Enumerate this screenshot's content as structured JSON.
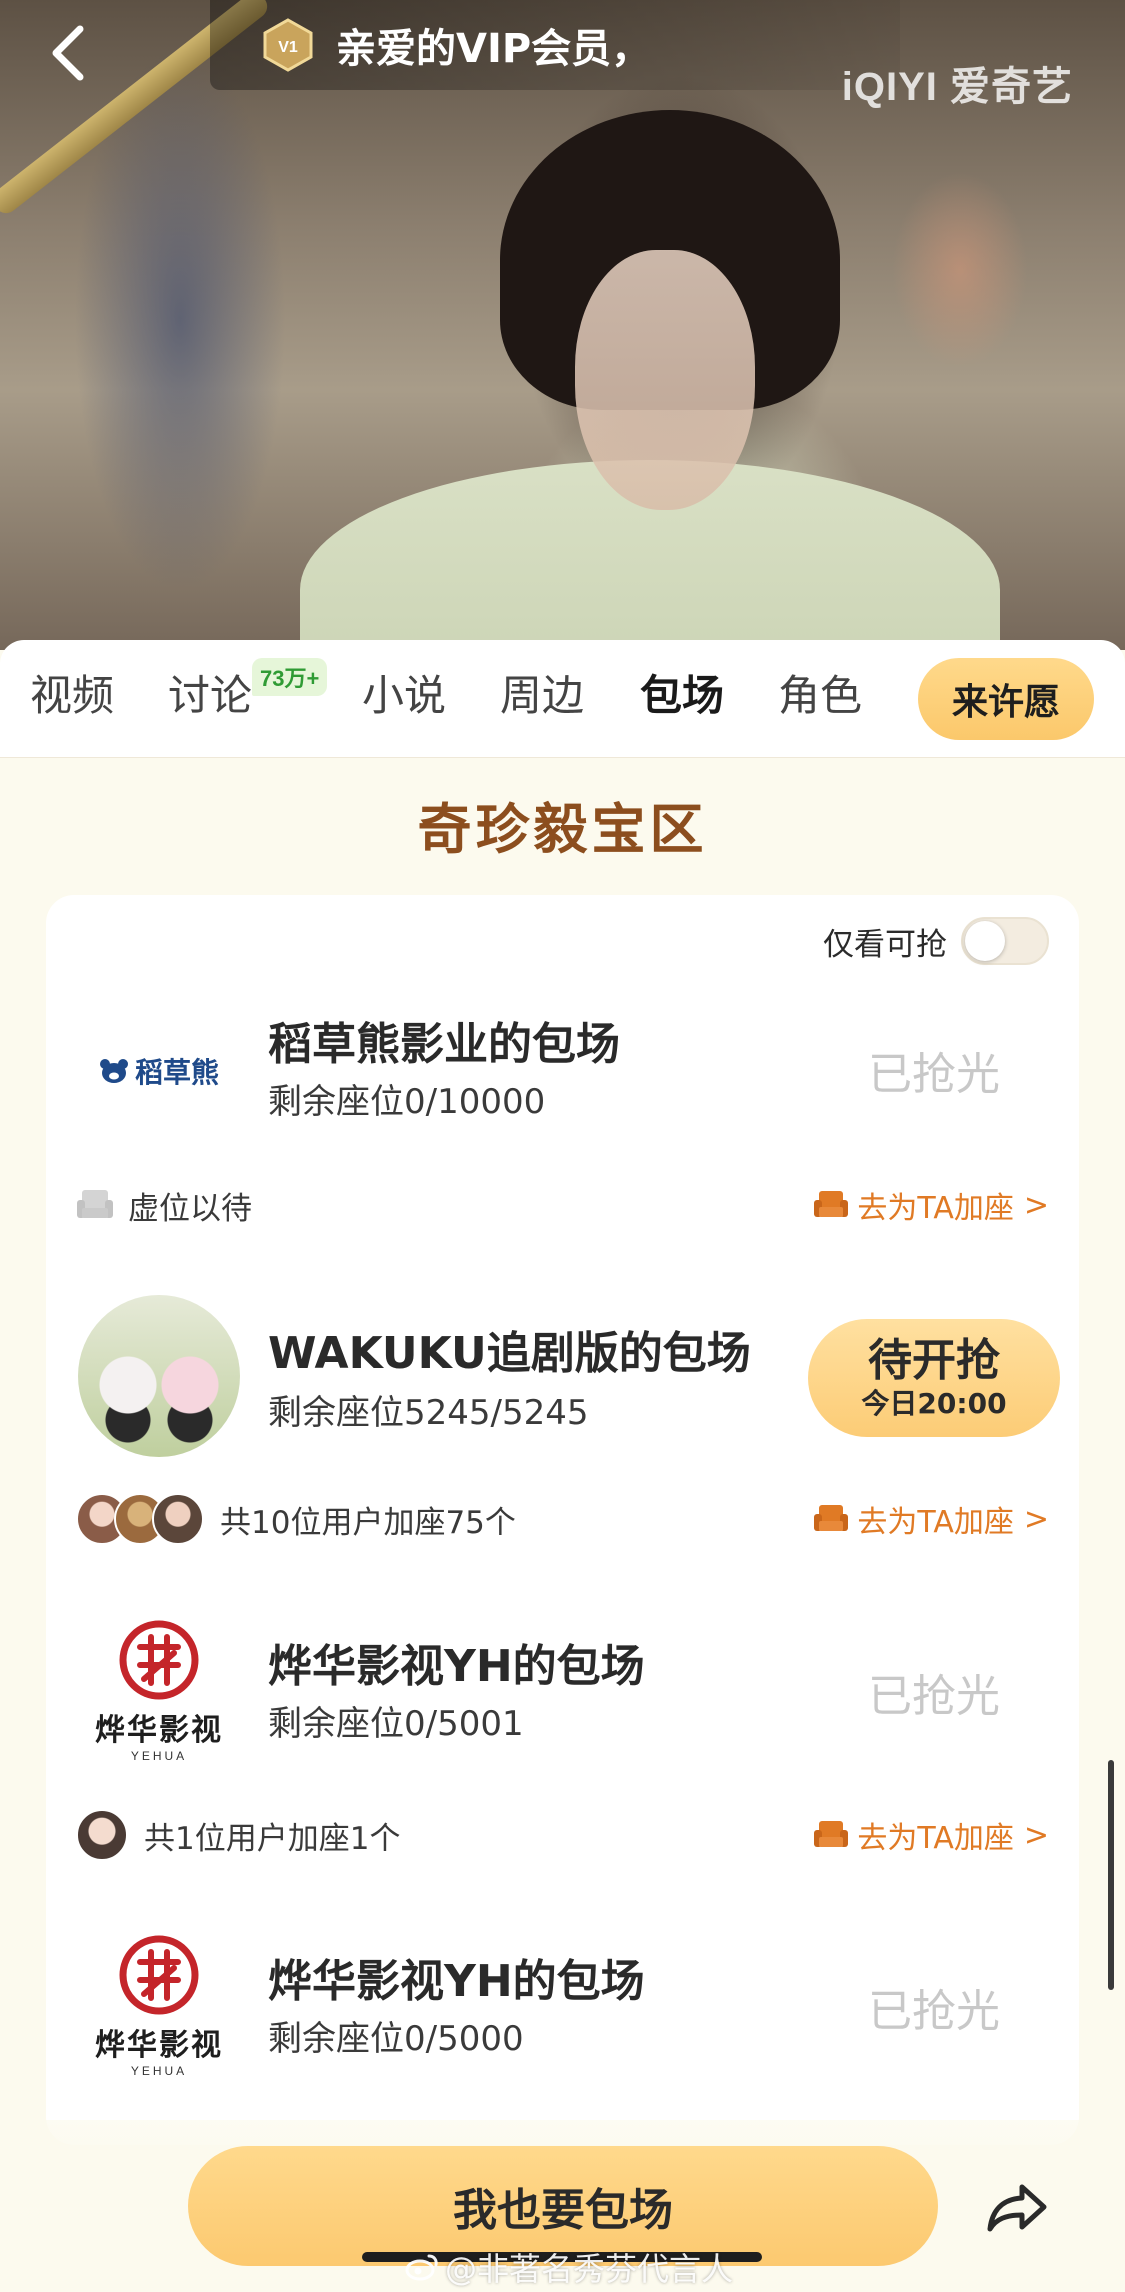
{
  "header": {
    "vip_greeting": "亲爱的VIP会员，",
    "vip_badge_label": "V1",
    "platform_logo": "iQIYI 爱奇艺"
  },
  "tabs": [
    {
      "label": "视频"
    },
    {
      "label": "讨论",
      "badge": "73万+"
    },
    {
      "label": "小说"
    },
    {
      "label": "周边"
    },
    {
      "label": "包场",
      "active": true
    },
    {
      "label": "角色"
    }
  ],
  "wish_button": "来许愿",
  "section_title": "奇珍毅宝区",
  "filter": {
    "label": "仅看可抢",
    "enabled": false
  },
  "items": [
    {
      "logo_text": "稻草熊",
      "name": "稻草熊影业的包场",
      "seats": "剩余座位0/10000",
      "status": "已抢光",
      "footer_text": "虚位以待",
      "join_label": "去为TA加座",
      "join_chevron": ">"
    },
    {
      "name": "WAKUKU追剧版的包场",
      "seats": "剩余座位5245/5245",
      "status": "待开抢",
      "status_time": "今日20:00",
      "footer_text": "共10位用户加座75个",
      "join_label": "去为TA加座",
      "join_chevron": ">"
    },
    {
      "logo_cn": "烨华影视",
      "logo_en": "YEHUA",
      "name": "烨华影视YH的包场",
      "seats": "剩余座位0/5001",
      "status": "已抢光",
      "footer_text": "共1位用户加座1个",
      "join_label": "去为TA加座",
      "join_chevron": ">"
    },
    {
      "logo_cn": "烨华影视",
      "logo_en": "YEHUA",
      "name": "烨华影视YH的包场",
      "seats": "剩余座位0/5000",
      "status": "已抢光"
    }
  ],
  "cta_button": "我也要包场",
  "watermark": "@非著名秀芬代言人",
  "colors": {
    "accent_brown": "#8c4e1e",
    "cta_yellow": "#fcc970",
    "link_orange": "#e07a25",
    "sold_gray": "#c8c8c8",
    "page_bg": "#fcfaee"
  },
  "icons": [
    "back-arrow-icon",
    "vip-badge-icon",
    "sofa-icon",
    "share-arrow-icon",
    "weibo-icon"
  ]
}
